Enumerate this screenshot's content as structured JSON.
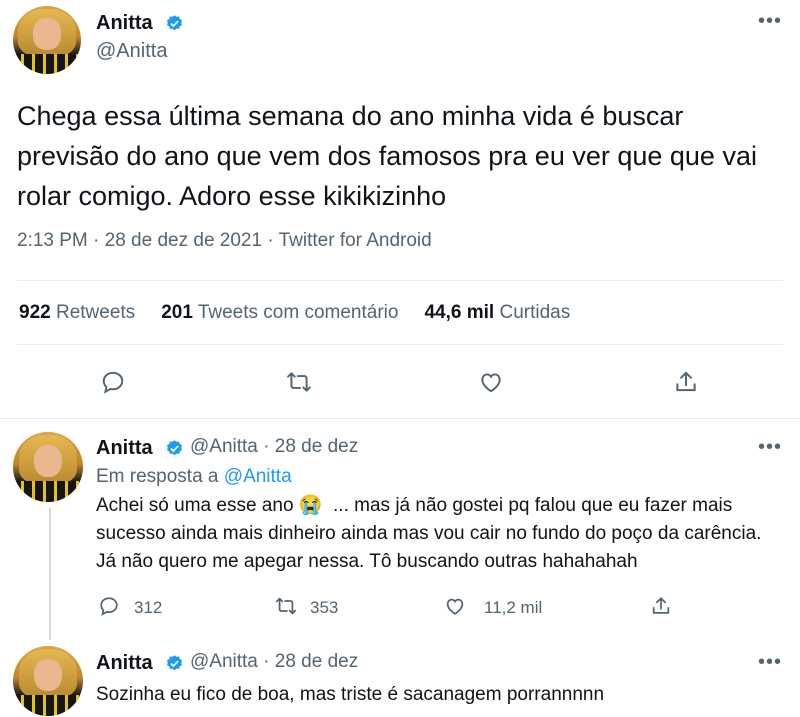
{
  "main_tweet": {
    "name": "Anitta",
    "handle": "@Anitta",
    "more_label": "•••",
    "text": "Chega essa última semana do ano minha vida é buscar previsão do ano que vem dos famosos pra eu ver que que vai rolar comigo. Adoro esse kikikizinho",
    "meta": "2:13 PM · 28 de dez de 2021 · Twitter for Android",
    "stats": {
      "retweets_count": "922",
      "retweets_label": "Retweets",
      "quotes_count": "201",
      "quotes_label": "Tweets com comentário",
      "likes_count": "44,6 mil",
      "likes_label": "Curtidas"
    },
    "icons": [
      "reply-icon",
      "retweet-icon",
      "like-icon",
      "share-icon"
    ]
  },
  "replies": [
    {
      "name": "Anitta",
      "handle": "@Anitta",
      "date": "· 28 de dez",
      "more_label": "•••",
      "reply_prefix": "Em resposta a",
      "reply_target": "@Anitta",
      "text_part1": "Achei só uma esse ano",
      "emoji": "😭",
      "text_part2": "... mas já não gostei pq falou que eu fazer mais sucesso ainda mais dinheiro ainda mas vou cair no fundo do poço da carência. Já não quero me apegar nessa. Tô buscando outras hahahahah",
      "reply_count": "312",
      "retweet_count": "353",
      "like_count": "11,2 mil"
    },
    {
      "name": "Anitta",
      "handle": "@Anitta",
      "date": "· 28 de dez",
      "more_label": "•••",
      "text": "Sozinha eu fico de boa, mas triste é sacanagem porrannnnn"
    }
  ],
  "colors": {
    "text": "#0f1419",
    "secondary": "#536471",
    "link": "#1d9bf0",
    "divider": "#e6ecf0"
  }
}
